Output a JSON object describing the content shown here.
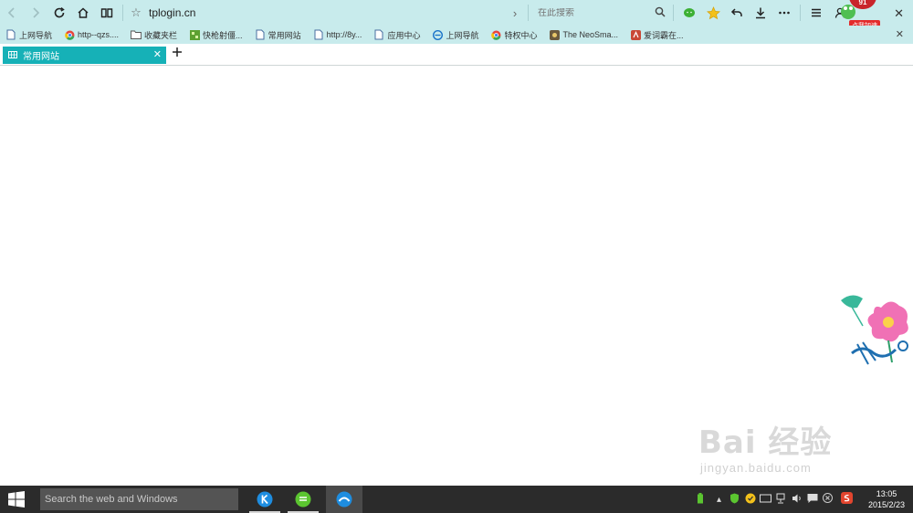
{
  "toolbar": {
    "url": "tplogin.cn",
    "search_placeholder": "在此搜索",
    "badge_count": "91",
    "badge_label": "点我加速"
  },
  "bookmarks": [
    {
      "label": "上网导航",
      "icon": "page-icon"
    },
    {
      "label": "http--qzs....",
      "icon": "chrome-icon"
    },
    {
      "label": "收藏夹栏",
      "icon": "folder-icon"
    },
    {
      "label": "快枪射僵...",
      "icon": "game-icon"
    },
    {
      "label": "常用网站",
      "icon": "page-icon"
    },
    {
      "label": "http://8y...",
      "icon": "page-icon"
    },
    {
      "label": "应用中心",
      "icon": "page-icon"
    },
    {
      "label": "上网导航",
      "icon": "ie-icon"
    },
    {
      "label": "特权中心",
      "icon": "chrome-icon"
    },
    {
      "label": "The NeoSma...",
      "icon": "app-icon"
    },
    {
      "label": "爱词霸在...",
      "icon": "dictionary-icon"
    }
  ],
  "tab": {
    "label": "常用网站"
  },
  "watermark": {
    "main": "Bai 经验",
    "sub": "jingyan.baidu.com"
  },
  "taskbar": {
    "search_placeholder": "Search the web and Windows",
    "time": "13:05",
    "date": "2015/2/23"
  },
  "colors": {
    "toolbar_bg": "#c8ebec",
    "tab_active": "#16b1b7",
    "taskbar_bg": "#2b2b2b"
  }
}
